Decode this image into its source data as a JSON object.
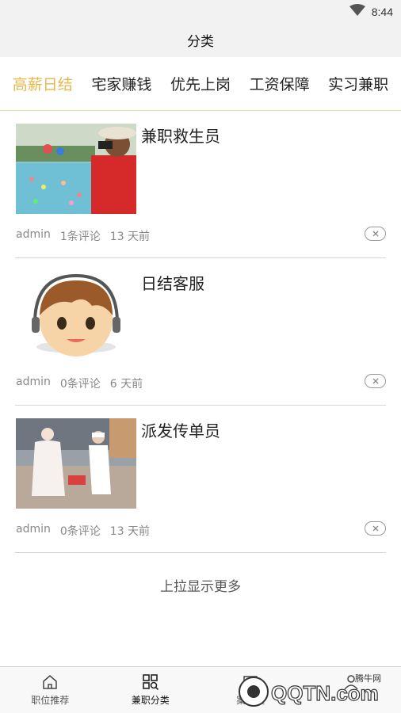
{
  "status_bar": {
    "time": "8:44",
    "icons": [
      "wifi-icon",
      "battery-icon"
    ]
  },
  "header": {
    "title": "分类"
  },
  "tabs": [
    {
      "label": "高薪日结",
      "active": true
    },
    {
      "label": "宅家赚钱",
      "active": false
    },
    {
      "label": "优先上岗",
      "active": false
    },
    {
      "label": "工资保障",
      "active": false
    },
    {
      "label": "实习兼职",
      "active": false
    }
  ],
  "items": [
    {
      "title": "兼职救生员",
      "author": "admin",
      "comments": "1条评论",
      "time": "13 天前",
      "image": "lifeguard-photo"
    },
    {
      "title": "日结客服",
      "author": "admin",
      "comments": "0条评论",
      "time": "6 天前",
      "image": "customer-service-cartoon"
    },
    {
      "title": "派发传单员",
      "author": "admin",
      "comments": "0条评论",
      "time": "13 天前",
      "image": "flyer-distribution-photo"
    }
  ],
  "load_more": "上拉显示更多",
  "tabbar": [
    {
      "label": "职位推荐",
      "icon": "home-icon",
      "active": false
    },
    {
      "label": "兼职分类",
      "icon": "category-search-icon",
      "active": true
    },
    {
      "label": "案例展",
      "icon": "showcase-icon",
      "active": false
    },
    {
      "label": "",
      "icon": "user-icon",
      "active": false
    }
  ],
  "watermark": {
    "text": "QQTN.com",
    "sub": "腾牛网"
  },
  "colors": {
    "accent": "#e6b84a",
    "divider": "#d6d6d6",
    "tab_underline": "#e6e0a8"
  }
}
